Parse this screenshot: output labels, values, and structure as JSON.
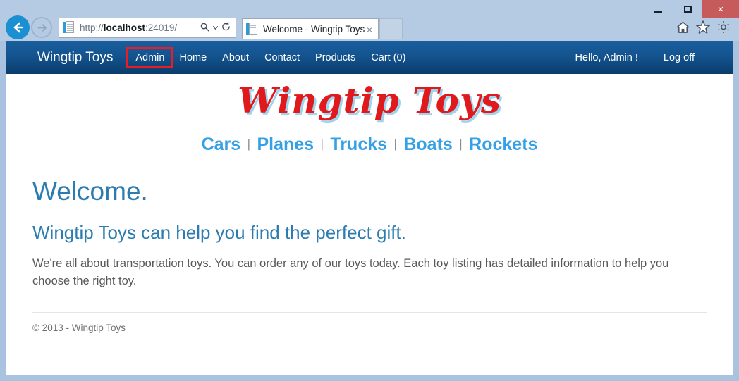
{
  "browser": {
    "window_controls": {
      "minimize": "minimize-button",
      "maximize": "maximize-button",
      "close_label": "×"
    },
    "back_label": "←",
    "forward_label": "→",
    "address": {
      "prefix": "http://",
      "host": "localhost",
      "suffix": ":24019/",
      "full": "http://localhost:24019/",
      "search_icon": "search-icon",
      "dropdown_icon": "chevron-down-icon",
      "refresh_icon": "refresh-icon",
      "refresh_label": "↻",
      "search_label": "⌕"
    },
    "tab": {
      "title": "Welcome - Wingtip Toys",
      "close_label": "×"
    },
    "toolbar_icons": [
      {
        "name": "home-icon",
        "glyph": "⌂"
      },
      {
        "name": "favorites-star-icon",
        "glyph": "★"
      },
      {
        "name": "settings-gear-icon",
        "glyph": "⚙"
      }
    ]
  },
  "site": {
    "brand": "Wingtip Toys",
    "nav_items": [
      {
        "label": "Admin",
        "highlighted": true
      },
      {
        "label": "Home",
        "highlighted": false
      },
      {
        "label": "About",
        "highlighted": false
      },
      {
        "label": "Contact",
        "highlighted": false
      },
      {
        "label": "Products",
        "highlighted": false
      },
      {
        "label": "Cart (0)",
        "highlighted": false
      }
    ],
    "user_greeting": "Hello, Admin !",
    "logoff_label": "Log off",
    "logo_text": "Wingtip Toys",
    "categories": [
      "Cars",
      "Planes",
      "Trucks",
      "Boats",
      "Rockets"
    ],
    "category_separator": "|",
    "heading": "Welcome.",
    "subheading": "Wingtip Toys can help you find the perfect gift.",
    "body": "We're all about transportation toys. You can order any of our toys today. Each toy listing has detailed information to help you choose the right toy.",
    "footer": "© 2013 - Wingtip Toys"
  },
  "colors": {
    "navbar_top": "#1a5e9e",
    "navbar_bottom": "#0a3c6b",
    "highlight_box": "#ec1c24",
    "logo_red": "#e0191c",
    "logo_shadow": "#9fd4ef",
    "category_blue": "#35a0e6",
    "heading_blue": "#2d7cb0",
    "window_frame": "#a9c2e0",
    "close_button": "#c75b5b"
  }
}
